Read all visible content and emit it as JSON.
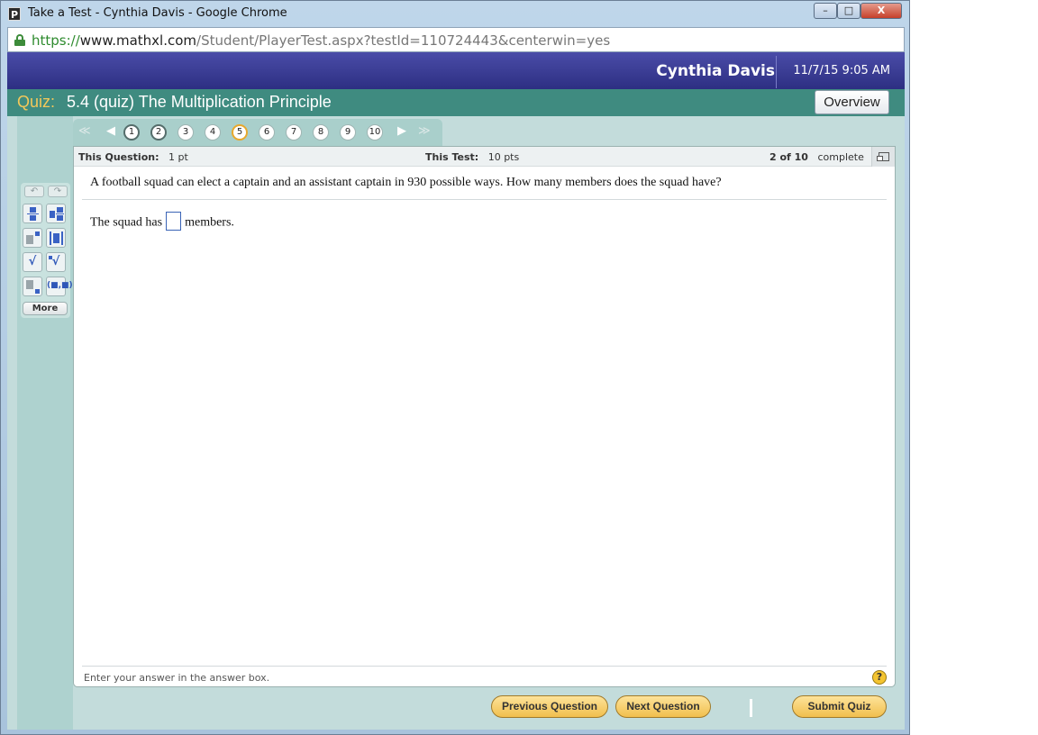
{
  "browser": {
    "window_title": "Take a Test - Cynthia Davis - Google Chrome",
    "app_icon_letter": "P",
    "url_protocol": "https://",
    "url_host": "www.mathxl.com",
    "url_path": "/Student/PlayerTest.aspx?testId=110724443&centerwin=yes",
    "minimize_glyph": "–",
    "maximize_glyph": "□",
    "close_glyph": "X"
  },
  "header": {
    "user_name": "Cynthia Davis",
    "datetime": "11/7/15 9:05 AM"
  },
  "quiz": {
    "label": "Quiz:",
    "title": "5.4 (quiz) The Multiplication Principle",
    "overview_label": "Overview"
  },
  "question_nav": {
    "first_glyph": "≪",
    "prev_glyph": "◀",
    "next_glyph": "▶",
    "last_glyph": "≫",
    "numbers": [
      {
        "n": "1",
        "state": "done"
      },
      {
        "n": "2",
        "state": "done"
      },
      {
        "n": "3",
        "state": "todo"
      },
      {
        "n": "4",
        "state": "todo"
      },
      {
        "n": "5",
        "state": "current"
      },
      {
        "n": "6",
        "state": "todo"
      },
      {
        "n": "7",
        "state": "todo"
      },
      {
        "n": "8",
        "state": "todo"
      },
      {
        "n": "9",
        "state": "todo"
      },
      {
        "n": "10",
        "state": "todo"
      }
    ]
  },
  "info": {
    "this_question_label": "This Question:",
    "this_question_value": "1 pt",
    "this_test_label": "This Test:",
    "this_test_value": "10 pts",
    "progress_count": "2 of 10",
    "progress_label": "complete"
  },
  "question": {
    "text": "A football squad can elect a captain and an assistant captain in 930 possible ways. How many members does the squad have?",
    "answer_prefix": "The squad has",
    "answer_suffix": "members.",
    "answer_value": ""
  },
  "footer": {
    "hint": "Enter your answer in the answer box.",
    "help_glyph": "?"
  },
  "palette": {
    "undo_glyph": "↶",
    "redo_glyph": "↷",
    "more_label": "More",
    "sqrt_glyph": "√",
    "interval_glyph": "(■,■)"
  },
  "buttons": {
    "previous": "Previous Question",
    "next": "Next Question",
    "submit": "Submit Quiz"
  },
  "colors": {
    "header_blue": "#2d2f82",
    "quiz_bar": "#3f8b80",
    "quiz_label": "#f3c85a",
    "current_ring": "#e8a82d",
    "button_gold": "#f1bf4d"
  }
}
